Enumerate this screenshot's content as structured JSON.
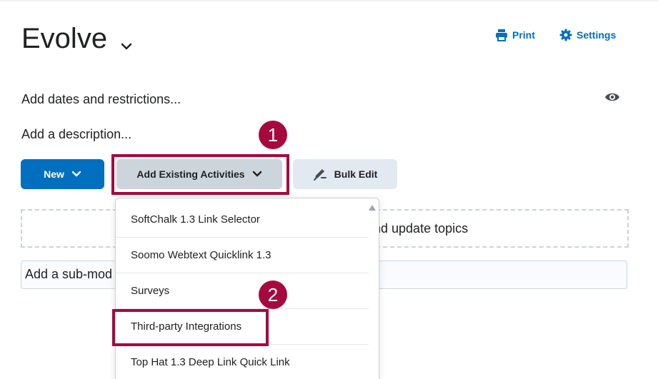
{
  "header": {
    "title": "Evolve",
    "print_label": "Print",
    "settings_label": "Settings"
  },
  "module": {
    "dates_link": "Add dates and restrictions...",
    "description_link": "Add a description..."
  },
  "toolbar": {
    "new_label": "New",
    "add_existing_label": "Add Existing Activities",
    "bulk_edit_label": "Bulk Edit"
  },
  "drop_zone_text": "nd update topics",
  "sub_module_text": "Add a sub-mod",
  "dropdown": {
    "items": [
      {
        "label": "SoftChalk 1.3 Link Selector"
      },
      {
        "label": "Soomo Webtext Quicklink 1.3"
      },
      {
        "label": "Surveys"
      },
      {
        "label": "Third-party Integrations"
      },
      {
        "label": "Top Hat 1.3 Deep Link Quick Link"
      }
    ]
  },
  "callouts": {
    "one": "1",
    "two": "2"
  },
  "colors": {
    "primary": "#006fbf",
    "callout": "#a6093d"
  }
}
